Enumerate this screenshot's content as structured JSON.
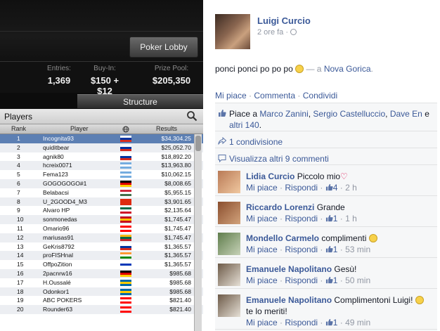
{
  "poker": {
    "lobby_button": "Poker Lobby",
    "stats": {
      "entries_label": "Entries:",
      "entries_value": "1,369",
      "buyin_label": "Buy-In:",
      "buyin_value": "$150 + $12",
      "prize_label": "Prize Pool:",
      "prize_value": "$205,350"
    },
    "structure_tab": "Structure",
    "players_title": "Players",
    "columns": {
      "rank": "Rank",
      "player": "Player",
      "results": "Results"
    },
    "rows": [
      {
        "rank": "1",
        "name": "Incognita93",
        "result": "$34,304.25",
        "flag": [
          "#ffffff",
          "#0033a0",
          "#d52b1e"
        ]
      },
      {
        "rank": "2",
        "name": "quiditbear",
        "result": "$25,052.70",
        "flag": [
          "#ffffff",
          "#0033a0",
          "#d52b1e"
        ]
      },
      {
        "rank": "3",
        "name": "agnik80",
        "result": "$18,892.20",
        "flag": [
          "#ffffff",
          "#0033a0",
          "#d52b1e"
        ]
      },
      {
        "rank": "4",
        "name": "hcreix0071",
        "result": "$13,963.80",
        "flag": [
          "#74acdf",
          "#ffffff",
          "#74acdf"
        ]
      },
      {
        "rank": "5",
        "name": "Fema123",
        "result": "$10,062.15",
        "flag": [
          "#74acdf",
          "#ffffff",
          "#74acdf"
        ]
      },
      {
        "rank": "6",
        "name": "GOGOGOGO#1",
        "result": "$8,008.65",
        "flag": [
          "#000000",
          "#dd0000",
          "#ffce00"
        ]
      },
      {
        "rank": "7",
        "name": "Belabacsi",
        "result": "$5,955.15",
        "flag": [
          "#cd2a3e",
          "#ffffff",
          "#436f4d"
        ]
      },
      {
        "rank": "8",
        "name": "U_2GOOD4_M3",
        "result": "$3,901.65",
        "flag": [
          "#de2910",
          "#de2910",
          "#de2910"
        ]
      },
      {
        "rank": "9",
        "name": "Alvaro HP",
        "result": "$2,135.64",
        "flag": [
          "#006847",
          "#ffffff",
          "#ce1126"
        ]
      },
      {
        "rank": "10",
        "name": "sonmonedas",
        "result": "$1,745.47",
        "flag": [
          "#c60b1e",
          "#ffc400",
          "#c60b1e"
        ]
      },
      {
        "rank": "11",
        "name": "Omario96",
        "result": "$1,745.47",
        "flag": [
          "#ff0000",
          "#ffffff",
          "#ff0000"
        ]
      },
      {
        "rank": "12",
        "name": "mariusas91",
        "result": "$1,745.47",
        "flag": [
          "#fdb913",
          "#006a44",
          "#c1272d"
        ]
      },
      {
        "rank": "13",
        "name": "GeKris8792",
        "result": "$1,365.57",
        "flag": [
          "#ffffff",
          "#0033a0",
          "#d52b1e"
        ]
      },
      {
        "rank": "14",
        "name": "proFISHnal",
        "result": "$1,365.57",
        "flag": [
          "#ff9933",
          "#ffffff",
          "#138808"
        ]
      },
      {
        "rank": "15",
        "name": "OffpoZition",
        "result": "$1,365.57",
        "flag": [
          "#ffffff",
          "#0038b8",
          "#ffffff"
        ]
      },
      {
        "rank": "16",
        "name": "2pacnrw16",
        "result": "$985.68",
        "flag": [
          "#000000",
          "#dd0000",
          "#ffce00"
        ]
      },
      {
        "rank": "17",
        "name": "H.Oussalé",
        "result": "$985.68",
        "flag": [
          "#006aa7",
          "#fecc00",
          "#006aa7"
        ]
      },
      {
        "rank": "18",
        "name": "Odonkor1",
        "result": "$985.68",
        "flag": [
          "#006aa7",
          "#fecc00",
          "#006aa7"
        ]
      },
      {
        "rank": "19",
        "name": "ABC POKERS",
        "result": "$821.40",
        "flag": [
          "#ff0000",
          "#ffffff",
          "#ff0000"
        ]
      },
      {
        "rank": "20",
        "name": "Rounder63",
        "result": "$821.40",
        "flag": [
          "#ff0000",
          "#ffffff",
          "#ff0000"
        ]
      }
    ]
  },
  "post": {
    "author": "Luigi Curcio",
    "time": "2 ore fa ·",
    "text": "ponci ponci po po po",
    "location_prefix": "— a",
    "location": "Nova Gorica",
    "location_suffix": ".",
    "actions": {
      "like": "Mi piace",
      "comment": "Commenta",
      "share": "Condividi",
      "separator": "·"
    },
    "likes": {
      "prefix": "Piace a",
      "names": [
        "Marco Zanini",
        "Sergio Castelluccio",
        "Dave En"
      ],
      "joiner": ",",
      "and": "e",
      "others": "altri 140",
      "suffix": "."
    },
    "shares": "1 condivisione",
    "more_comments": "Visualizza altri 9 commenti"
  },
  "comments": [
    {
      "name": "Lidia Curcio",
      "text": "Piccolo mio",
      "emoji": "heart",
      "like": "Mi piace",
      "reply": "Rispondi",
      "likes": "4",
      "time": "2 h",
      "avatar": [
        "#b97a56",
        "#f0c8a0"
      ]
    },
    {
      "name": "Riccardo Lorenzi",
      "text": "Grande",
      "emoji": "",
      "like": "Mi piace",
      "reply": "Rispondi",
      "likes": "1",
      "time": "1 h",
      "avatar": [
        "#8a4e2e",
        "#d2a37c"
      ]
    },
    {
      "name": "Mondello Carmelo",
      "text": "complimenti",
      "emoji": "smile",
      "like": "Mi piace",
      "reply": "Rispondi",
      "likes": "1",
      "time": "53 min",
      "avatar": [
        "#5f7d4c",
        "#c7d2b8"
      ]
    },
    {
      "name": "Emanuele Napolitano",
      "text": "Gesù!",
      "emoji": "",
      "like": "Mi piace",
      "reply": "Rispondi",
      "likes": "1",
      "time": "50 min",
      "avatar": [
        "#6d5a48",
        "#e6e0d6"
      ]
    },
    {
      "name": "Emanuele Napolitano",
      "text": "Complimentoni Luigi!",
      "text2": "te lo meriti!",
      "emoji": "smile",
      "like": "Mi piace",
      "reply": "Rispondi",
      "likes": "1",
      "time": "49 min",
      "avatar": [
        "#6d5a48",
        "#e6e0d6"
      ]
    }
  ],
  "colors": {
    "fb_link": "#3b5998",
    "fb_meta": "#9197a3",
    "poker_selected": "#5c7fb3"
  }
}
